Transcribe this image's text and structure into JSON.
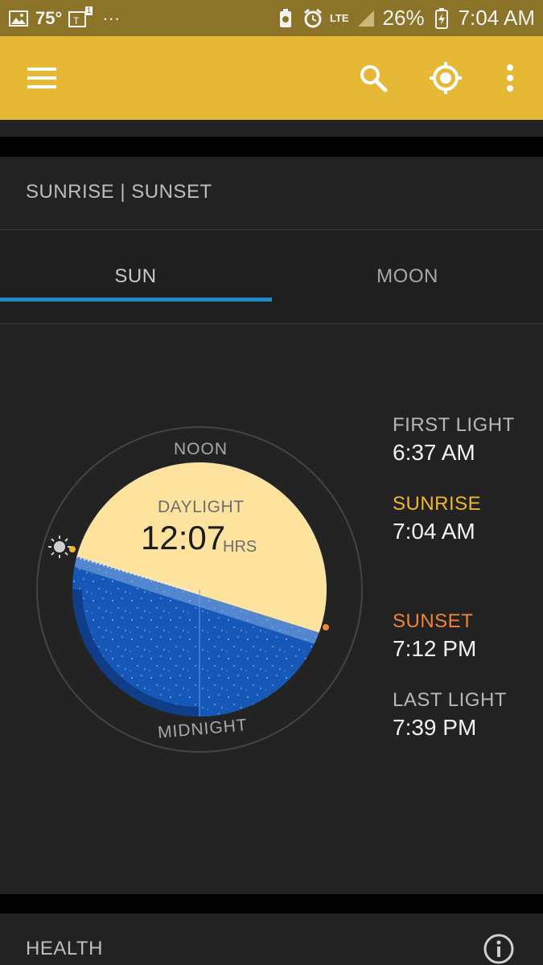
{
  "status_bar": {
    "temperature": "75°",
    "badge_number": "1",
    "dots": "···",
    "network": "LTE",
    "battery": "26%",
    "time": "7:04 AM"
  },
  "app_bar": {
    "icons": [
      "menu-icon",
      "search-icon",
      "locate-icon",
      "more-vert-icon"
    ],
    "accent_color": "#e5b935"
  },
  "card": {
    "title": "SUNRISE | SUNSET",
    "tabs": [
      {
        "label": "SUN",
        "selected": true
      },
      {
        "label": "MOON",
        "selected": false
      }
    ],
    "dial": {
      "noon_label": "NOON",
      "midnight_label": "MIDNIGHT",
      "daylight_label": "DAYLIGHT",
      "daylight_value": "12:07",
      "daylight_unit": "HRS"
    },
    "times": [
      {
        "label": "FIRST LIGHT",
        "value": "6:37 AM",
        "color": "#b8b8b8"
      },
      {
        "label": "SUNRISE",
        "value": "7:04 AM",
        "color": "#f0b62c"
      },
      {
        "label": "SUNSET",
        "value": "7:12 PM",
        "color": "#f0843a"
      },
      {
        "label": "LAST LIGHT",
        "value": "7:39 PM",
        "color": "#b8b8b8"
      }
    ]
  },
  "health_card": {
    "title": "HEALTH"
  }
}
